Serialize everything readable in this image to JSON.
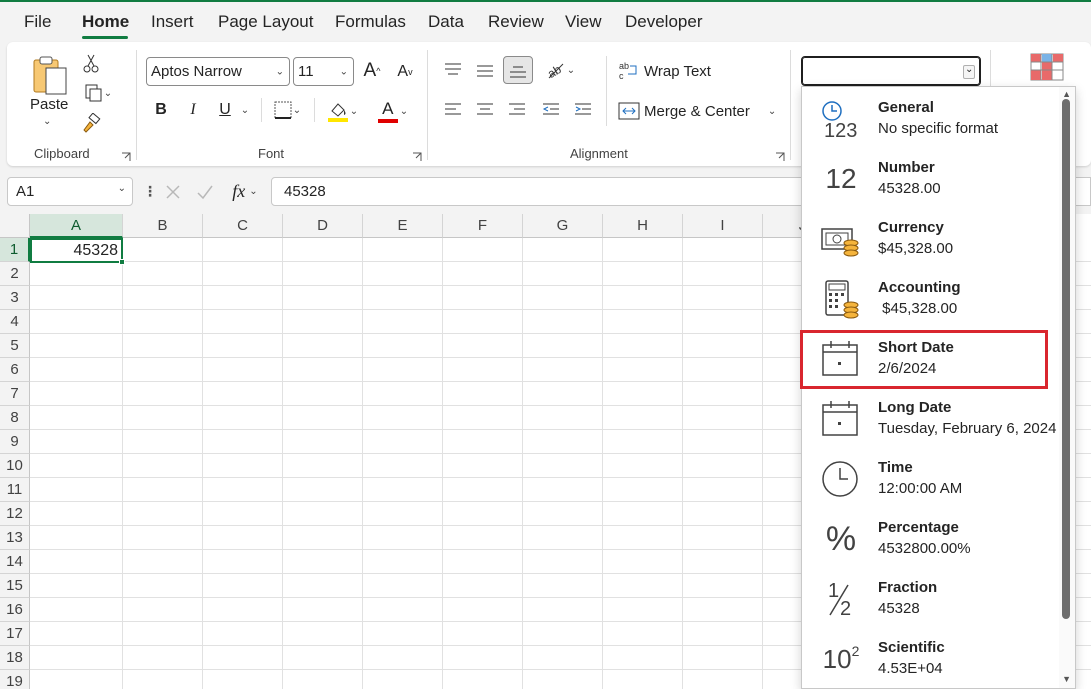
{
  "tabs": [
    {
      "label": "File",
      "active": false
    },
    {
      "label": "Home",
      "active": true
    },
    {
      "label": "Insert",
      "active": false
    },
    {
      "label": "Page Layout",
      "active": false
    },
    {
      "label": "Formulas",
      "active": false
    },
    {
      "label": "Data",
      "active": false
    },
    {
      "label": "Review",
      "active": false
    },
    {
      "label": "View",
      "active": false
    },
    {
      "label": "Developer",
      "active": false
    }
  ],
  "clipboard": {
    "paste_label": "Paste",
    "group_label": "Clipboard"
  },
  "font": {
    "family": "Aptos Narrow",
    "size": "11",
    "group_label": "Font",
    "bold": "B",
    "italic": "I",
    "underline": "U",
    "font_color_glyph": "A",
    "grow_glyph": "A",
    "shrink_glyph": "A"
  },
  "alignment": {
    "wrap_label": "Wrap Text",
    "merge_label": "Merge & Center",
    "group_label": "Alignment"
  },
  "formula_bar": {
    "name_box": "A1",
    "formula": "45328",
    "fx": "fx"
  },
  "grid": {
    "columns": [
      "A",
      "B",
      "C",
      "D",
      "E",
      "F",
      "G",
      "H",
      "I",
      "J"
    ],
    "rows": [
      "1",
      "2",
      "3",
      "4",
      "5",
      "6",
      "7",
      "8",
      "9",
      "10",
      "11",
      "12",
      "13",
      "14",
      "15",
      "16",
      "17",
      "18",
      "19"
    ],
    "a1_value": "45328"
  },
  "number_format_menu": {
    "current_value": "",
    "items": [
      {
        "name": "General",
        "example": "No specific format",
        "icon": "general-123-icon"
      },
      {
        "name": "Number",
        "example": "45328.00",
        "icon": "number-12-icon"
      },
      {
        "name": "Currency",
        "example": "$45,328.00",
        "icon": "currency-icon"
      },
      {
        "name": "Accounting",
        "example": " $45,328.00",
        "icon": "accounting-icon"
      },
      {
        "name": "Short Date",
        "example": "2/6/2024",
        "icon": "calendar-icon"
      },
      {
        "name": "Long Date",
        "example": "Tuesday, February 6, 2024",
        "icon": "calendar-icon"
      },
      {
        "name": "Time",
        "example": "12:00:00 AM",
        "icon": "clock-icon"
      },
      {
        "name": "Percentage",
        "example": "4532800.00%",
        "icon": "percent-icon"
      },
      {
        "name": "Fraction",
        "example": "45328",
        "icon": "fraction-icon"
      },
      {
        "name": "Scientific",
        "example": "4.53E+04",
        "icon": "scientific-icon"
      }
    ],
    "highlighted": "Short Date"
  },
  "icon_text": {
    "general_top": "",
    "general_bottom": "123",
    "number": "12",
    "percent": "%",
    "fraction_num": "1",
    "fraction_den": "2",
    "sci_base": "10",
    "sci_exp": "2"
  },
  "colors": {
    "accent": "#107c41",
    "highlight": "#d9262e",
    "fill_yellow": "#ffe600",
    "font_red": "#e00000"
  }
}
